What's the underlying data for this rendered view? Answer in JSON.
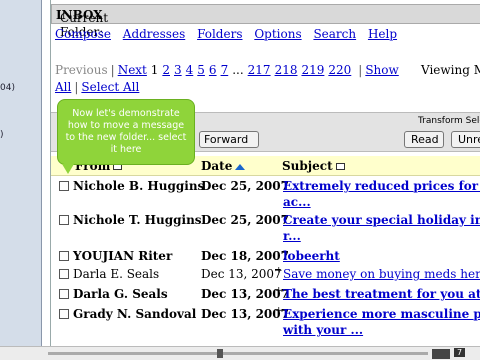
{
  "left_frame": {
    "fragments": [
      "04)",
      ")"
    ]
  },
  "folder_bar": {
    "label": "Current Folder:",
    "folder": "INBOX"
  },
  "menu": [
    "Compose",
    "Addresses",
    "Folders",
    "Options",
    "Search",
    "Help"
  ],
  "pager": {
    "previous": "Previous",
    "next": "Next",
    "pages_a": [
      "1",
      "2",
      "3",
      "4",
      "5",
      "6",
      "7"
    ],
    "ellipsis": "...",
    "pages_b": [
      "217",
      "218",
      "219",
      "220"
    ],
    "show": "Show",
    "all": "All",
    "select_all": "Select All",
    "sep": "|"
  },
  "viewing": "Viewing Me",
  "toolbar": {
    "transform_label": "Transform Sele",
    "forward": "Forward",
    "read": "Read",
    "unread": "Unrea"
  },
  "columns": {
    "from": "From",
    "date": "Date",
    "subject": "Subject"
  },
  "messages": [
    {
      "from": "Nichole B. Huggins",
      "date": "Dec 25, 2007",
      "subject_l1": "Extremely reduced prices for the mo",
      "subject_l2": "ac...",
      "plus": false,
      "unread": true
    },
    {
      "from": "Nichole T. Huggins",
      "date": "Dec 25, 2007",
      "subject_l1": "Create your special holiday image wi",
      "subject_l2": "r...",
      "plus": false,
      "unread": true
    },
    {
      "from": "YOUJIAN Riter",
      "date": "Dec 18, 2007",
      "subject_l1": "lobeerht",
      "subject_l2": "",
      "plus": false,
      "unread": true
    },
    {
      "from": "Darla E. Seals",
      "date": "Dec 13, 2007",
      "subject_l1": "Save money on buying meds here!",
      "subject_l2": "",
      "plus": true,
      "unread": false
    },
    {
      "from": "Darla G. Seals",
      "date": "Dec 13, 2007",
      "subject_l1": "The best treatment for you at low pri",
      "subject_l2": "",
      "plus": true,
      "unread": true
    },
    {
      "from": "Grady N. Sandoval",
      "date": "Dec 13, 2007",
      "subject_l1": "Experience more masculine power in",
      "subject_l2": "with your ...",
      "plus": true,
      "unread": true
    }
  ],
  "callout": "Now let's demonstrate how to move a message to the new folder... select it here",
  "player": {
    "time": "7"
  },
  "colors": {
    "link": "#0000cc",
    "header_bg": "#ffffcc",
    "callout": "#8fd43a",
    "folder_bar": "#d9d9d9"
  }
}
